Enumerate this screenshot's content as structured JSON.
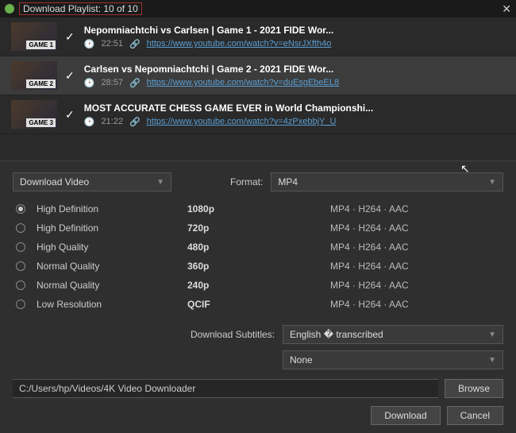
{
  "titlebar": {
    "title": "Download Playlist: 10 of 10"
  },
  "playlist": [
    {
      "badge": "GAME 1",
      "title": "Nepomniachtchi vs Carlsen | Game 1 - 2021 FIDE Wor...",
      "duration": "22:51",
      "url": "https://www.youtube.com/watch?v=eNsrJXfth4o",
      "selected": false
    },
    {
      "badge": "GAME 2",
      "title": "Carlsen vs Nepomniachtchi | Game 2 - 2021 FIDE Wor...",
      "duration": "28:57",
      "url": "https://www.youtube.com/watch?v=duEsgEbeEL8",
      "selected": true
    },
    {
      "badge": "GAME 3",
      "title": "MOST ACCURATE CHESS GAME EVER in World Championshi...",
      "duration": "21:22",
      "url": "https://www.youtube.com/watch?v=4zPxebbjY_U",
      "selected": false
    }
  ],
  "action": {
    "label": "Download Video"
  },
  "format": {
    "label": "Format:",
    "value": "MP4"
  },
  "qualities": [
    {
      "label": "High Definition",
      "res": "1080p",
      "codec": "MP4 · H264 · AAC",
      "on": true
    },
    {
      "label": "High Definition",
      "res": "720p",
      "codec": "MP4 · H264 · AAC",
      "on": false
    },
    {
      "label": "High Quality",
      "res": "480p",
      "codec": "MP4 · H264 · AAC",
      "on": false
    },
    {
      "label": "Normal Quality",
      "res": "360p",
      "codec": "MP4 · H264 · AAC",
      "on": false
    },
    {
      "label": "Normal Quality",
      "res": "240p",
      "codec": "MP4 · H264 · AAC",
      "on": false
    },
    {
      "label": "Low Resolution",
      "res": "QCIF",
      "codec": "MP4 · H264 · AAC",
      "on": false
    }
  ],
  "subtitles": {
    "label": "Download Subtitles:",
    "lang": "English � transcribed",
    "second": "None"
  },
  "path": {
    "value": "C:/Users/hp/Videos/4K Video Downloader",
    "browse": "Browse"
  },
  "buttons": {
    "download": "Download",
    "cancel": "Cancel"
  }
}
